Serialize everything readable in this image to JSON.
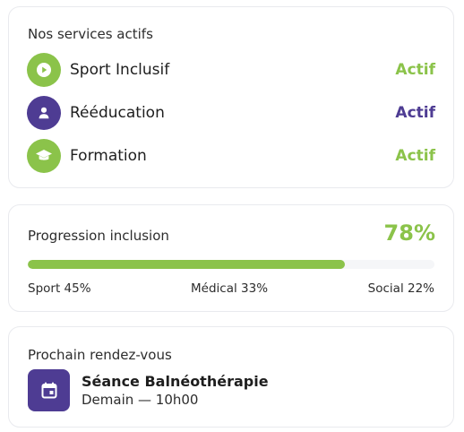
{
  "colors": {
    "green": "#8bc34a",
    "purple": "#4e3c93",
    "text": "#1e1e1e",
    "border": "#e9eaee"
  },
  "services": {
    "title": "Nos services actifs",
    "items": [
      {
        "name": "Sport Inclusif",
        "status": "Actif",
        "icon": "play-circle-icon",
        "color": "#8bc34a"
      },
      {
        "name": "Rééducation",
        "status": "Actif",
        "icon": "person-icon",
        "color": "#4e3c93"
      },
      {
        "name": "Formation",
        "status": "Actif",
        "icon": "graduation-cap-icon",
        "color": "#8bc34a"
      }
    ]
  },
  "progress": {
    "title": "Progression inclusion",
    "value_label": "78%",
    "fill_fraction": 0.78,
    "legend": [
      "Sport 45%",
      "Médical 33%",
      "Social 22%"
    ]
  },
  "appointment": {
    "title": "Prochain rendez-vous",
    "name": "Séance Balnéothérapie",
    "time": "Demain — 10h00",
    "icon": "calendar-icon"
  }
}
